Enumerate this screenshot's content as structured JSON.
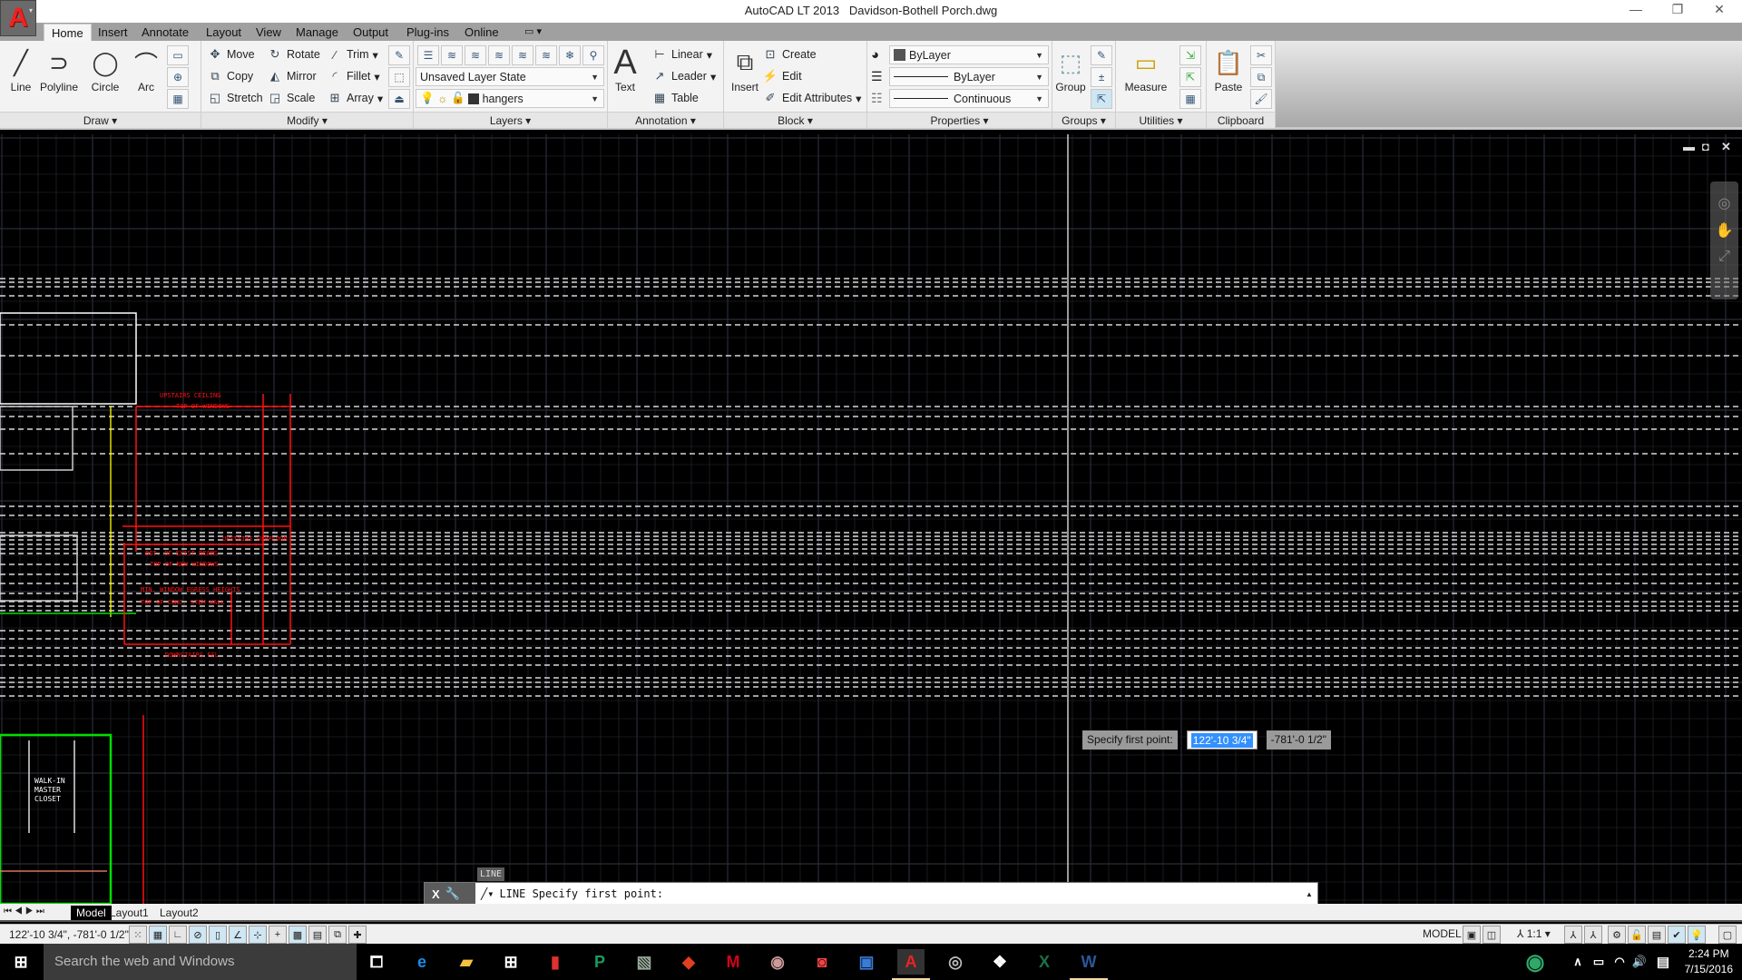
{
  "window": {
    "title": "AutoCAD LT 2013",
    "filename": "Davidson-Bothell Porch.dwg",
    "minimize": "—",
    "restore": "❐",
    "close": "✕"
  },
  "app_button": {
    "logo": "A",
    "arrow": "▾"
  },
  "tabs": [
    {
      "label": "Home",
      "active": true
    },
    {
      "label": "Insert"
    },
    {
      "label": "Annotate"
    },
    {
      "label": "Layout"
    },
    {
      "label": "View"
    },
    {
      "label": "Manage"
    },
    {
      "label": "Output"
    },
    {
      "label": "Plug-ins"
    },
    {
      "label": "Online"
    }
  ],
  "tab_extra": "▭ ▾",
  "ribbon": {
    "draw": {
      "title": "Draw ▾",
      "line": "Line",
      "polyline": "Polyline",
      "circle": "Circle",
      "arc": "Arc"
    },
    "modify": {
      "title": "Modify ▾",
      "move": "Move",
      "rotate": "Rotate",
      "trim": "Trim",
      "copy": "Copy",
      "mirror": "Mirror",
      "fillet": "Fillet",
      "stretch": "Stretch",
      "scale": "Scale",
      "array": "Array"
    },
    "layers": {
      "title": "Layers ▾",
      "layer_state": "Unsaved Layer State",
      "current_layer": "hangers"
    },
    "annotation": {
      "title": "Annotation ▾",
      "text": "Text",
      "linear": "Linear",
      "leader": "Leader",
      "table": "Table"
    },
    "block": {
      "title": "Block ▾",
      "insert": "Insert",
      "create": "Create",
      "edit": "Edit",
      "edit_attributes": "Edit Attributes"
    },
    "properties": {
      "title": "Properties ▾",
      "color": "ByLayer",
      "lineweight": "ByLayer",
      "linetype": "Continuous"
    },
    "groups": {
      "title": "Groups ▾",
      "group": "Group"
    },
    "utilities": {
      "title": "Utilities ▾",
      "measure": "Measure"
    },
    "clipboard": {
      "title": "Clipboard",
      "paste": "Paste"
    }
  },
  "drawing": {
    "annotations": [
      "UPSTAIRS CEILING",
      "TOP OF WINDOWS",
      "UPSTAIRS SUBFLOOR",
      "BOT. OF EXIST BEAMS",
      "TOP OF NEW WINDOWS",
      "MIN. WINDOW EGRESS HEIGHTS",
      "TOP OF CONC. STEM WALL",
      "DOWNSTAIRS FFL"
    ],
    "room_label": [
      "WALK-IN",
      "MASTER",
      "CLOSET"
    ],
    "colors": {
      "grid": "#2a2d38",
      "dashed": "#ffffff",
      "red": "#ff1010",
      "yellow": "#ffff00",
      "green": "#00e000",
      "salmon": "#ff8a70"
    }
  },
  "dynamic_input": {
    "prompt": "Specify first point:",
    "x_value": "122'-10 3/4\"",
    "y_value": "-781'-0 1/2\""
  },
  "command_line": {
    "tooltip": "LINE",
    "text": "LINE Specify first point:",
    "close": "X",
    "up_arrow": "▲"
  },
  "layout_tabs": [
    {
      "label": "Model",
      "active": true
    },
    {
      "label": "Layout1"
    },
    {
      "label": "Layout2"
    }
  ],
  "status": {
    "coordinates": "122'-10 3/4\", -781'-0 1/2\"",
    "model": "MODEL",
    "scale": "1:1"
  },
  "taskbar": {
    "search_placeholder": "Search the web and Windows",
    "time": "2:24 PM",
    "date": "7/15/2016"
  }
}
